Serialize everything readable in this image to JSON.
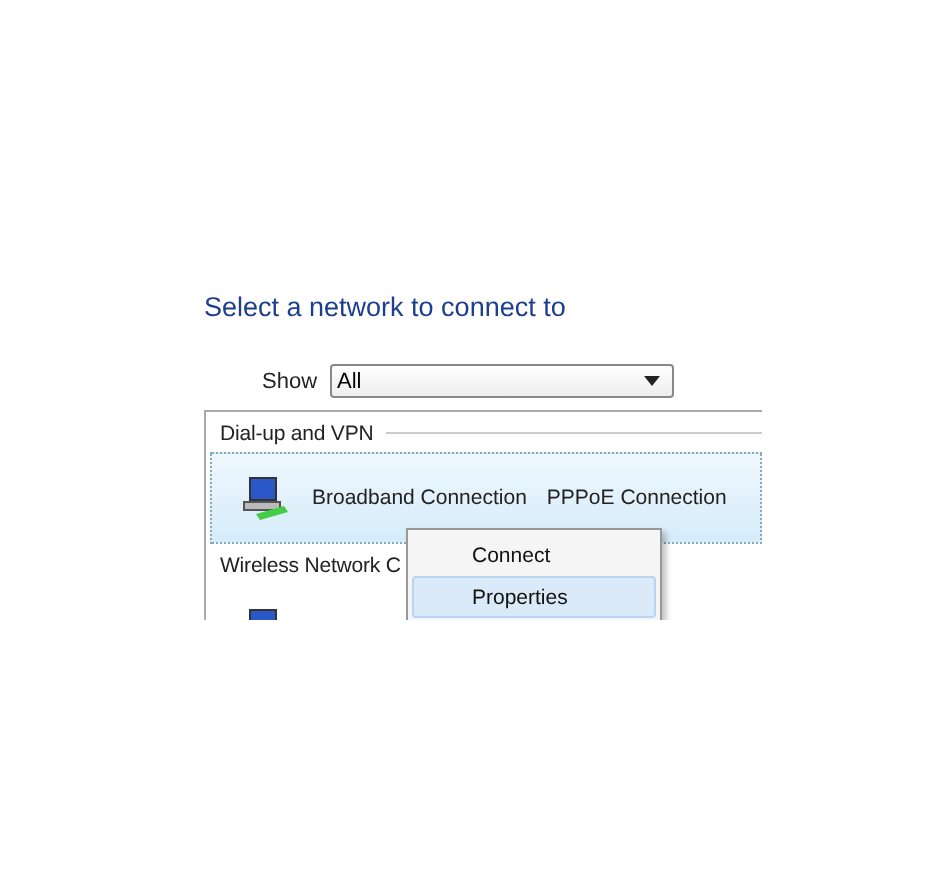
{
  "heading": "Select a network to connect to",
  "filter": {
    "label": "Show",
    "value": "All"
  },
  "groups": [
    {
      "title": "Dial-up and VPN",
      "connections": [
        {
          "name": "Broadband Connection",
          "type": "PPPoE Connection",
          "selected": true
        }
      ]
    },
    {
      "title": "Wireless Network C",
      "connections": [
        {
          "selected": false
        }
      ]
    }
  ],
  "context_menu": [
    {
      "label": "Connect",
      "selected": false
    },
    {
      "label": "Properties",
      "selected": true
    }
  ]
}
